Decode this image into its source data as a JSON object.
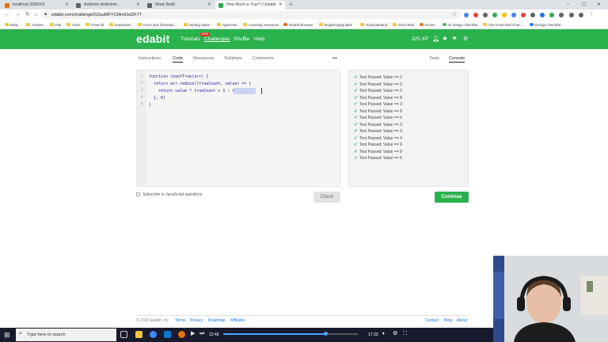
{
  "browser": {
    "tabs": [
      {
        "label": "localhost:3000/#/2",
        "active": false,
        "favicon_color": "#e8710a"
      },
      {
        "label": "Asdomm Asdmmm",
        "active": false,
        "favicon_color": "#5f6368"
      },
      {
        "label": "Mads Bodil",
        "active": false,
        "favicon_color": "#5f6368"
      },
      {
        "label": "How Much is True? // Edabit",
        "active": true,
        "favicon_color": "#2ab24c"
      },
      {
        "label": "",
        "active": false,
        "favicon_color": "#5f6368"
      }
    ],
    "new_tab": "+",
    "url": "edabit.com/challenge/G3uuMFYCMnxOuDF7T",
    "window_controls": [
      "–",
      "▢",
      "✕"
    ]
  },
  "bookmarks": [
    "Daily",
    "Articles",
    "Fak",
    "Tools",
    "Freecoll",
    "Inspiration",
    "Icons and illustratio...",
    "Writing ideas",
    "Agencies",
    "Learning resources",
    "Reddit Browser",
    "Bogføringsguiden",
    "Graduateland",
    "Zoho Mail",
    "Dovec",
    "UI design checklist",
    "The Front End Chec...",
    "Design checklist"
  ],
  "header": {
    "logo": "edabit",
    "nav": [
      "Tutorials",
      "Challenges",
      "Shuffle",
      "Help"
    ],
    "new_badge": "NEW",
    "xp": "325 XP",
    "accent_color": "#2ab24c"
  },
  "left_tabs": [
    "Instructions",
    "Code",
    "Resources",
    "Solutions",
    "Comments"
  ],
  "left_active_tab": "Code",
  "more_menu": "•••",
  "right_tabs": [
    "Tests",
    "Console"
  ],
  "right_active_tab": "Console",
  "editor": {
    "line_numbers": [
      "1",
      "2",
      "3",
      "4",
      "5"
    ],
    "lines": [
      "function countTrue(arr) {",
      "  return arr.reduce((trueCount, value) => {",
      "    return value ? trueCount + 1 : trueCount",
      "  }, 0)",
      "}"
    ]
  },
  "console": {
    "results": [
      "Test Passed: Value == 2",
      "Test Passed: Value == 0",
      "Test Passed: Value == 0",
      "Test Passed: Value == 8",
      "Test Passed: Value == 3",
      "Test Passed: Value == 8",
      "Test Passed: Value == 6",
      "Test Passed: Value == 3",
      "Test Passed: Value == 3",
      "Test Passed: Value == 4",
      "Test Passed: Value == 9",
      "Test Passed: Value == 8",
      "Test Passed: Value == 6"
    ]
  },
  "subscribe_label": "Subscribe to JavaScript questions",
  "check_label": "Check",
  "continue_label": "Continue",
  "footer": {
    "copyright": "© 2020 Edabit, Inc",
    "links_left": [
      "Terms",
      "Privacy",
      "Roadmap",
      "Affiliates"
    ],
    "links_right": [
      "Contact",
      "Blog",
      "About"
    ]
  },
  "taskbar": {
    "search_placeholder": "Type here to search",
    "media_time_current": "12:49",
    "media_time_total": "17:33",
    "media_progress": 0.76
  }
}
